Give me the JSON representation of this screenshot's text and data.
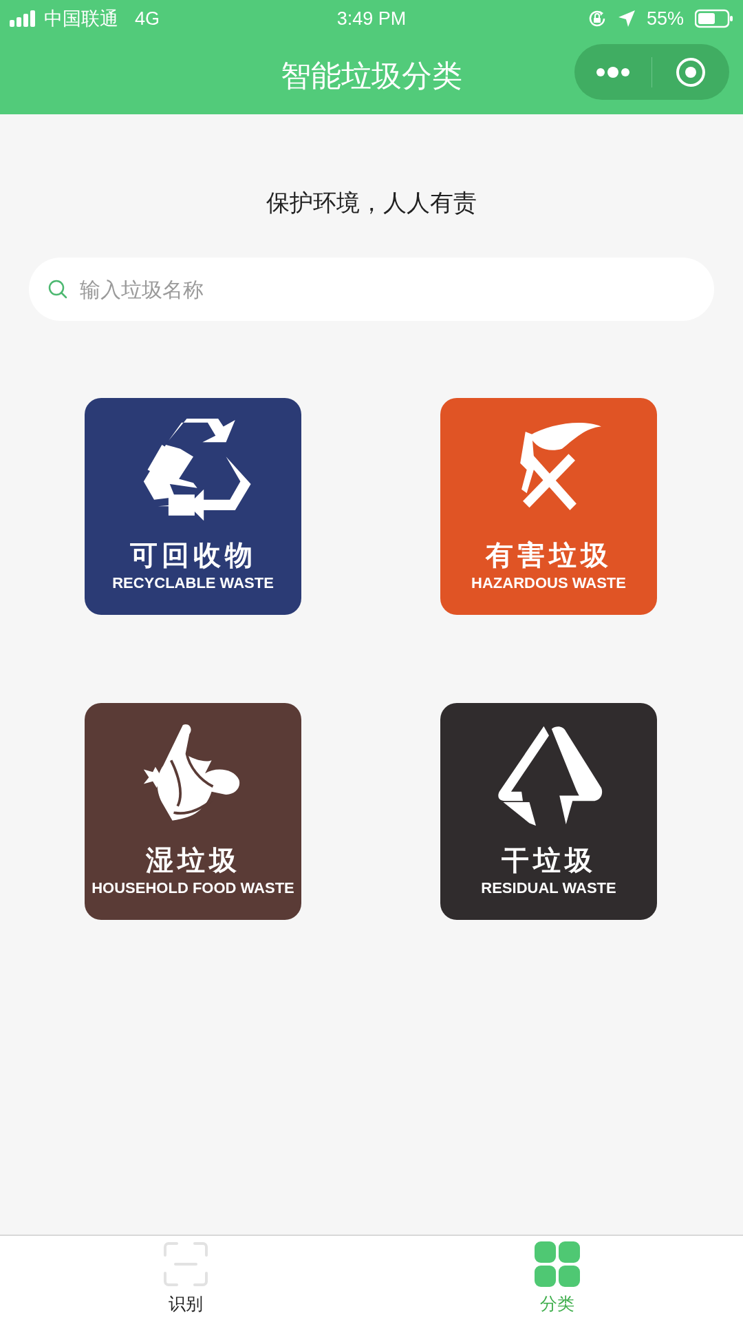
{
  "status_bar": {
    "carrier": "中国联通",
    "network": "4G",
    "time": "3:49 PM",
    "battery": "55%"
  },
  "nav_bar": {
    "title": "智能垃圾分类"
  },
  "slogan": "保护环境，人人有责",
  "search": {
    "placeholder": "输入垃圾名称"
  },
  "categories": [
    {
      "kind": "recyclable",
      "name": "可回收物",
      "english": "RECYCLABLE WASTE",
      "color": "#2b3b75"
    },
    {
      "kind": "hazardous",
      "name": "有害垃圾",
      "english": "HAZARDOUS WASTE",
      "color": "#e05425"
    },
    {
      "kind": "food",
      "name": "湿垃圾",
      "english": "HOUSEHOLD FOOD WASTE",
      "color": "#5a3b36"
    },
    {
      "kind": "residual",
      "name": "干垃圾",
      "english": "RESIDUAL WASTE",
      "color": "#302c2d"
    }
  ],
  "tabs": [
    {
      "kind": "scan",
      "label": "识别",
      "selected": false
    },
    {
      "kind": "grid",
      "label": "分类",
      "selected": true
    }
  ]
}
